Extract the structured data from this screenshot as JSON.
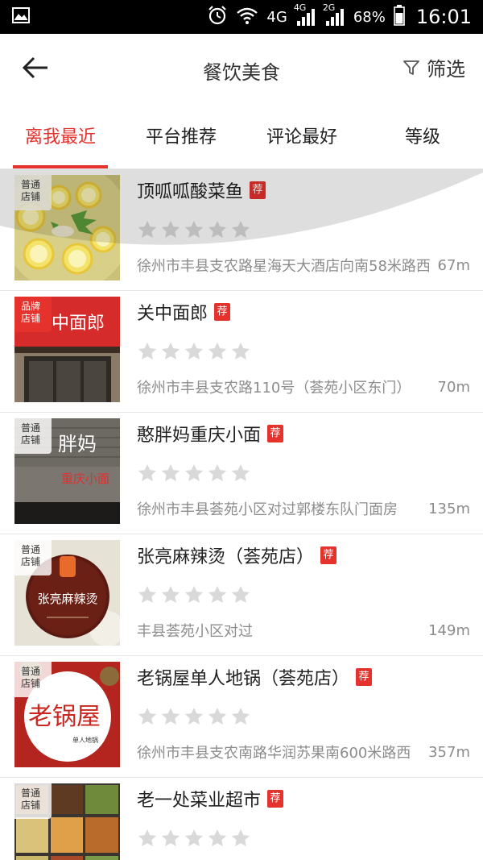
{
  "status_bar": {
    "network_4g": "4G",
    "network_4g_small": "4G",
    "network_2g_small": "2G",
    "battery": "68%",
    "time": "16:01"
  },
  "header": {
    "title": "餐饮美食",
    "filter_label": "筛选"
  },
  "tabs": [
    {
      "label": "离我最近",
      "active": true
    },
    {
      "label": "平台推荐",
      "active": false
    },
    {
      "label": "评论最好",
      "active": false
    },
    {
      "label": "等级",
      "active": false
    }
  ],
  "recommend_badge": "荐",
  "rating_max": 5,
  "shops": [
    {
      "tag_line1": "普通",
      "tag_line2": "店铺",
      "tag_type": "normal",
      "name": "顶呱呱酸菜鱼",
      "rating": 0,
      "address": "徐州市丰县支农路星海天大酒店向南58米路西",
      "distance": "67m",
      "image": "lemon-fish"
    },
    {
      "tag_line1": "品牌",
      "tag_line2": "店铺",
      "tag_type": "brand",
      "name": "关中面郎",
      "rating": 0,
      "address": "徐州市丰县支农路110号（荟苑小区东门）",
      "distance": "70m",
      "image": "storefront-guanzhong",
      "sign_text": "关中面郎"
    },
    {
      "tag_line1": "普通",
      "tag_line2": "店铺",
      "tag_type": "normal",
      "name": "憨胖妈重庆小面",
      "rating": 0,
      "address": "徐州市丰县荟苑小区对过郭楼东队门面房",
      "distance": "135m",
      "image": "storefront-hanpangma",
      "sign_text": "胖妈",
      "sign_text2": "重庆小面"
    },
    {
      "tag_line1": "普通",
      "tag_line2": "店铺",
      "tag_type": "normal",
      "name": "张亮麻辣烫（荟苑店）",
      "rating": 0,
      "address": "丰县荟苑小区对过",
      "distance": "149m",
      "image": "logo-zhangliang",
      "sign_text": "张亮麻辣烫"
    },
    {
      "tag_line1": "普通",
      "tag_line2": "店铺",
      "tag_type": "normal",
      "name": "老锅屋单人地锅（荟苑店）",
      "rating": 0,
      "address": "徐州市丰县支农南路华润苏果南600米路西",
      "distance": "357m",
      "image": "logo-laoguowu",
      "sign_text": "老锅屋",
      "sign_text2": "单人地锅"
    },
    {
      "tag_line1": "普通",
      "tag_line2": "店铺",
      "tag_type": "normal",
      "name": "老一处菜业超市",
      "rating": 0,
      "address": "",
      "distance": "",
      "image": "dishes-tray"
    }
  ],
  "colors": {
    "accent": "#e5322d",
    "star_empty": "#d9d9d9",
    "text_secondary": "#8c8c8c"
  }
}
